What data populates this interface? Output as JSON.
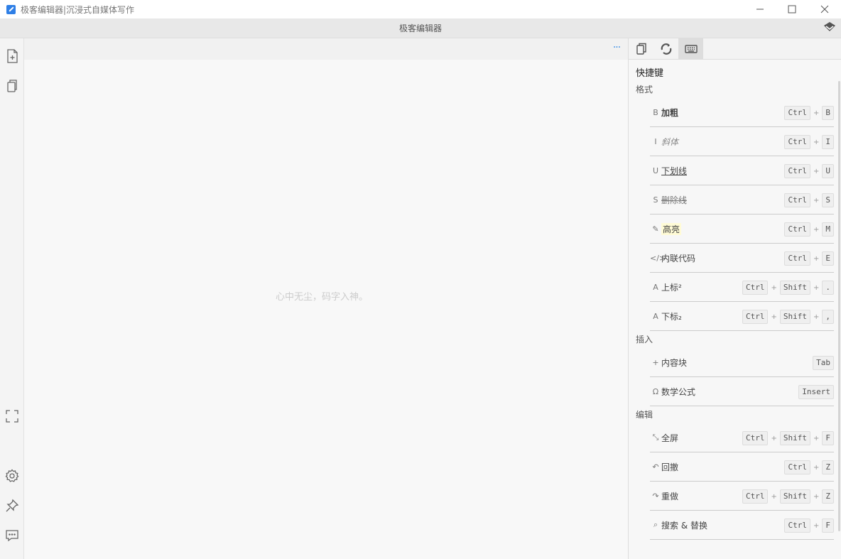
{
  "window": {
    "title": "极客编辑器|沉浸式自媒体写作",
    "minimize_glyph": "—",
    "maximize_glyph": "☐",
    "close_glyph": "✕"
  },
  "app": {
    "header_title": "极客编辑器"
  },
  "editor": {
    "placeholder": "心中无尘，码字入神。",
    "more_glyph": "···"
  },
  "panel": {
    "heading": "快捷键",
    "sections": [
      {
        "title": "格式",
        "items": [
          {
            "icon": "B",
            "label": "加粗",
            "keys": [
              "Ctrl",
              "B"
            ]
          },
          {
            "icon": "I",
            "label": "斜体",
            "keys": [
              "Ctrl",
              "I"
            ]
          },
          {
            "icon": "U",
            "label": "下划线",
            "keys": [
              "Ctrl",
              "U"
            ]
          },
          {
            "icon": "S",
            "label": "删除线",
            "keys": [
              "Ctrl",
              "S"
            ]
          },
          {
            "icon": "✎",
            "label": "高亮",
            "keys": [
              "Ctrl",
              "M"
            ]
          },
          {
            "icon": "</>",
            "label": "内联代码",
            "keys": [
              "Ctrl",
              "E"
            ]
          },
          {
            "icon": "A",
            "label": "上标²",
            "keys": [
              "Ctrl",
              "Shift",
              "."
            ]
          },
          {
            "icon": "A",
            "label": "下标₂",
            "keys": [
              "Ctrl",
              "Shift",
              ","
            ]
          }
        ]
      },
      {
        "title": "插入",
        "items": [
          {
            "icon": "+",
            "label": "内容块",
            "keys": [
              "Tab"
            ]
          },
          {
            "icon": "Ω",
            "label": "数学公式",
            "keys": [
              "Insert"
            ]
          }
        ]
      },
      {
        "title": "编辑",
        "items": [
          {
            "icon": "⤡",
            "label": "全屏",
            "keys": [
              "Ctrl",
              "Shift",
              "F"
            ]
          },
          {
            "icon": "↶",
            "label": "回撤",
            "keys": [
              "Ctrl",
              "Z"
            ]
          },
          {
            "icon": "↷",
            "label": "重做",
            "keys": [
              "Ctrl",
              "Shift",
              "Z"
            ]
          },
          {
            "icon": "⌕",
            "label": "搜索 & 替换",
            "keys": [
              "Ctrl",
              "F"
            ]
          }
        ]
      }
    ],
    "key_separator": "+"
  },
  "colors": {
    "accent": "#3a8ee6",
    "highlight": "#fffbd6"
  }
}
